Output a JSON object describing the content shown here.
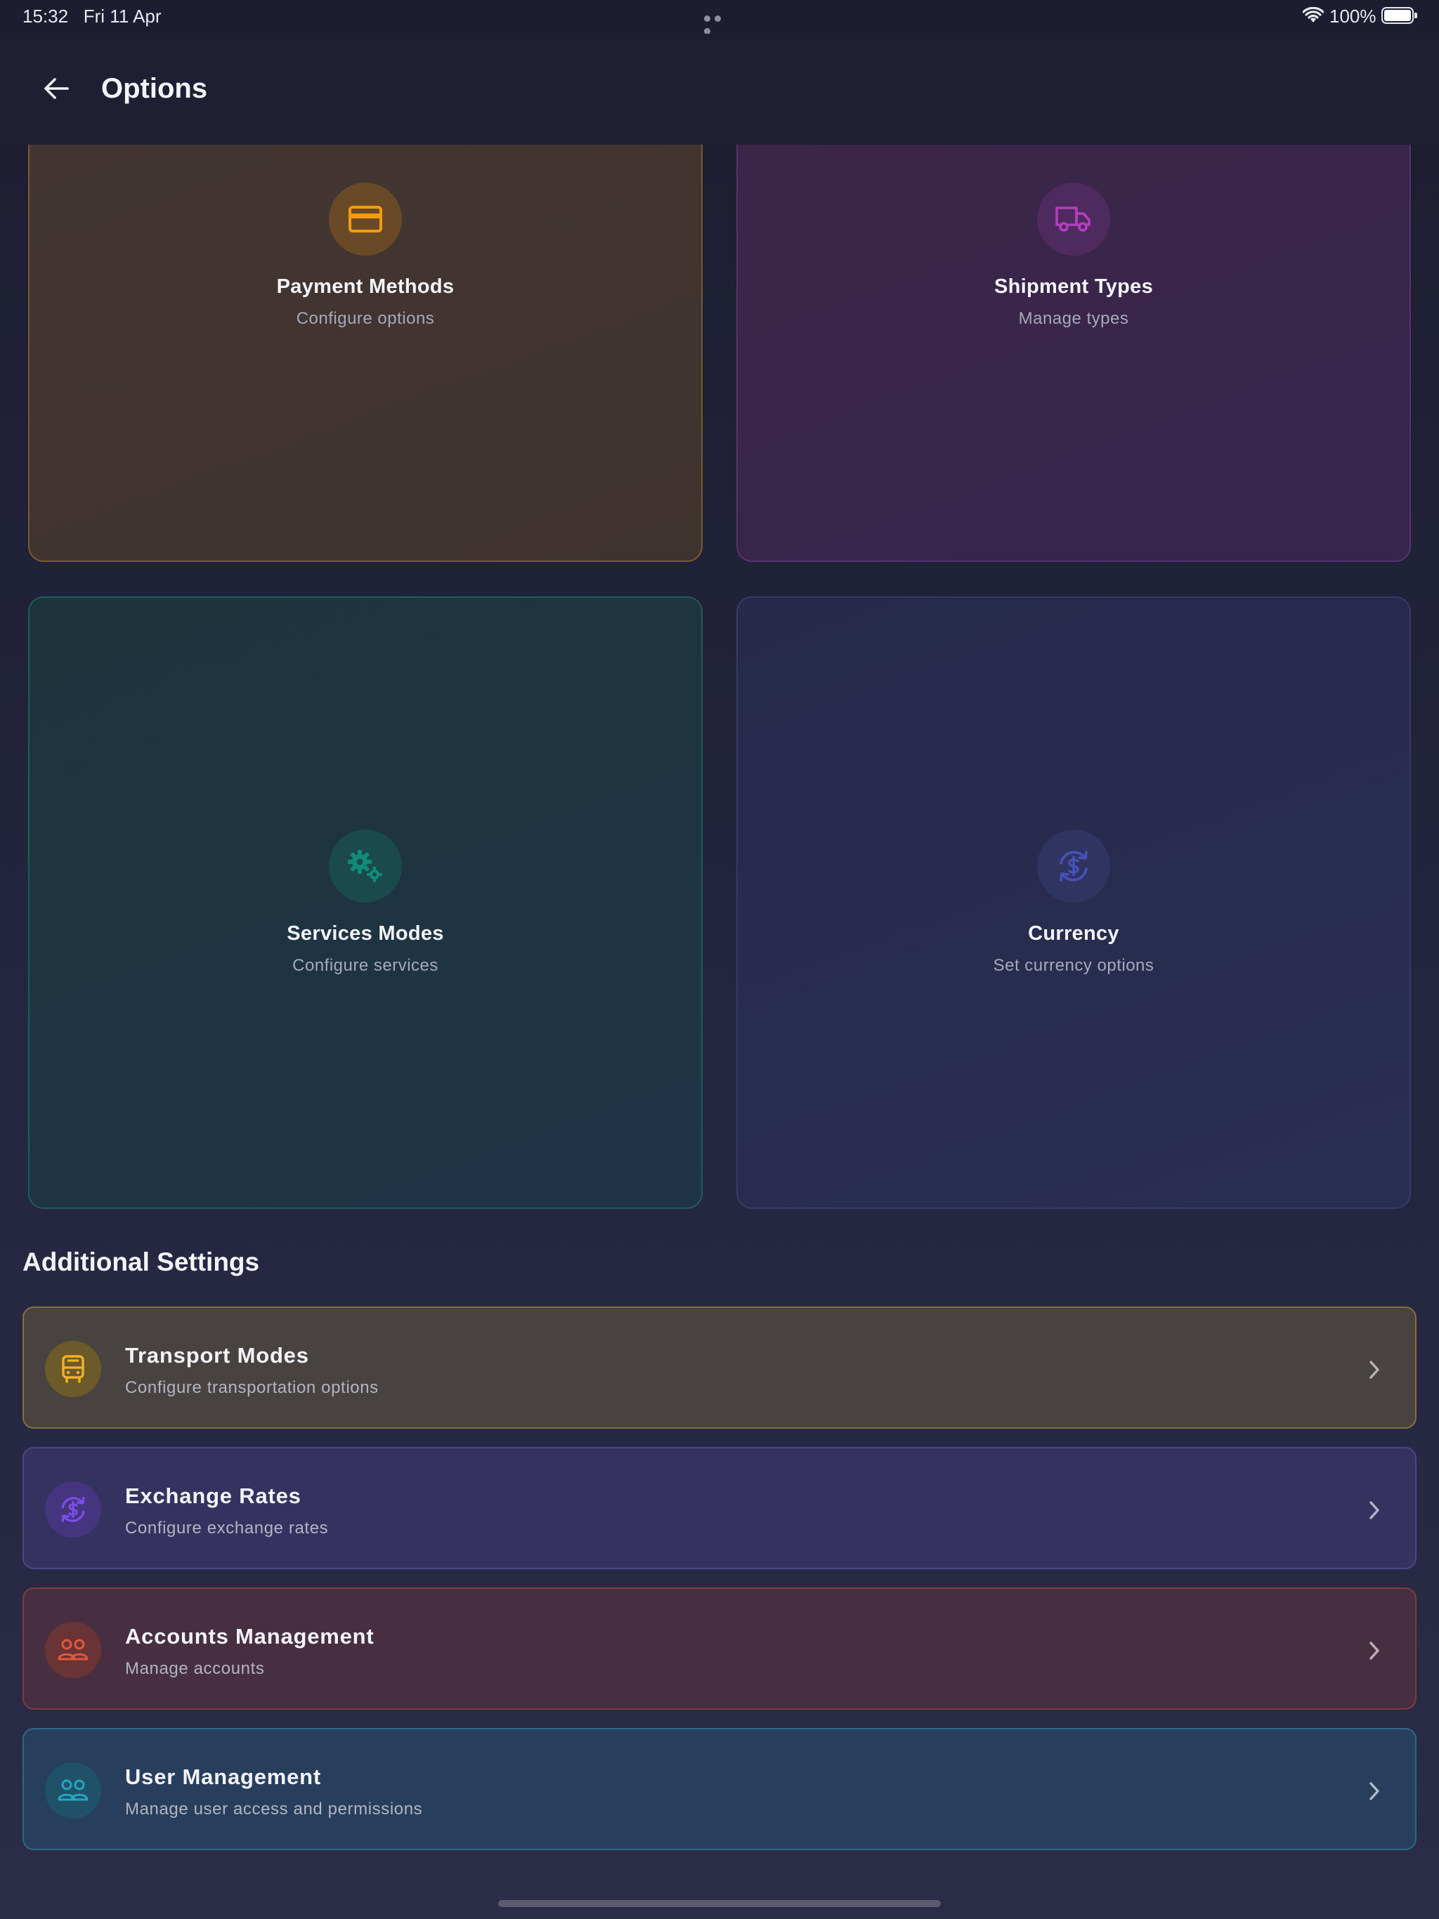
{
  "status_bar": {
    "time": "15:32",
    "date": "Fri 11 Apr",
    "battery": "100%"
  },
  "header": {
    "title": "Options",
    "back_icon": "arrow-left-icon"
  },
  "tiles": [
    {
      "title": "Payment Methods",
      "subtitle": "Configure options",
      "icon": "credit-card-icon",
      "accent": "#f39c12"
    },
    {
      "title": "Shipment Types",
      "subtitle": "Manage types",
      "icon": "truck-icon",
      "accent": "#b23fbf"
    },
    {
      "title": "Services Modes",
      "subtitle": "Configure services",
      "icon": "gears-icon",
      "accent": "#128a7a"
    },
    {
      "title": "Currency",
      "subtitle": "Set currency options",
      "icon": "currency-exchange-icon",
      "accent": "#4652b8"
    }
  ],
  "additional": {
    "title": "Additional Settings",
    "items": [
      {
        "title": "Transport Modes",
        "subtitle": "Configure transportation options",
        "icon": "bus-icon",
        "accent": "#f1b22a"
      },
      {
        "title": "Exchange Rates",
        "subtitle": "Configure exchange rates",
        "icon": "currency-exchange-icon",
        "accent": "#7b4dea"
      },
      {
        "title": "Accounts Management",
        "subtitle": "Manage accounts",
        "icon": "users-icon",
        "accent": "#e2583a"
      },
      {
        "title": "User Management",
        "subtitle": "Manage user access and permissions",
        "icon": "users-icon",
        "accent": "#22a6c4"
      }
    ]
  }
}
